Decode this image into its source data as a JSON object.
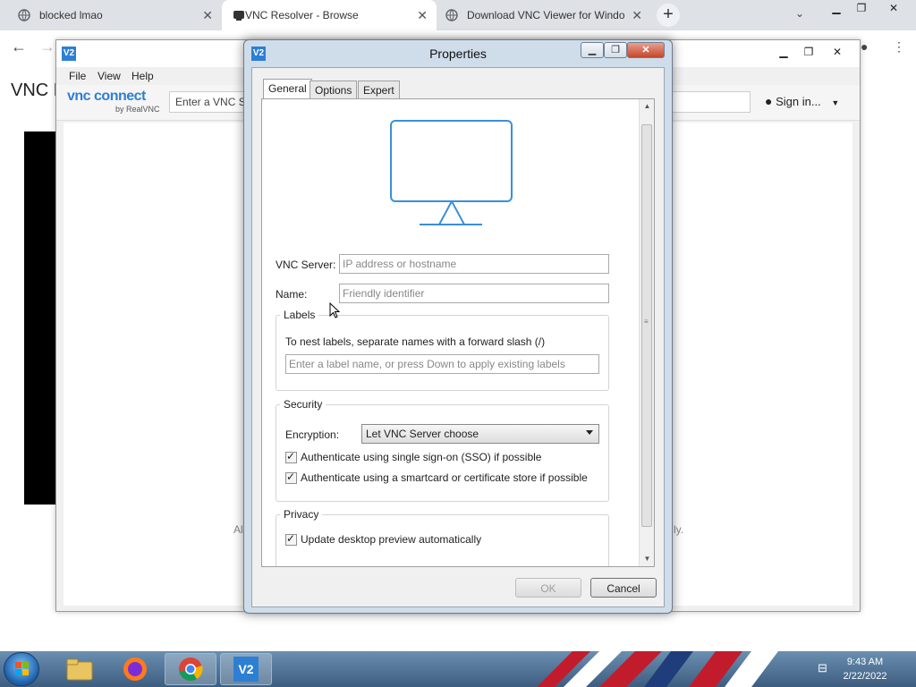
{
  "browser": {
    "tabs": [
      {
        "title": "blocked lmao",
        "active": false
      },
      {
        "title": "VNC Resolver - Browse",
        "active": true
      },
      {
        "title": "Download VNC Viewer for Windo",
        "active": false
      }
    ],
    "new_tab_symbol": "+",
    "page_heading_partial": "VNC R"
  },
  "vnc_window": {
    "menu": [
      "File",
      "View",
      "Help"
    ],
    "logo": "vnc connect",
    "logo_sub": "by RealVNC",
    "address_placeholder": "Enter a VNC Se",
    "sign_in": "Sign in...",
    "hidden_left": "Al",
    "hidden_right": "ly."
  },
  "dialog": {
    "title": "Properties",
    "app_icon_text": "V2",
    "tabs": [
      "General",
      "Options",
      "Expert"
    ],
    "selected_tab": "General",
    "vnc_server": {
      "label": "VNC Server:",
      "placeholder": "IP address or hostname"
    },
    "name": {
      "label": "Name:",
      "placeholder": "Friendly identifier"
    },
    "labels": {
      "legend": "Labels",
      "help": "To nest labels, separate names with a forward slash (/)",
      "placeholder": "Enter a label name, or press Down to apply existing labels"
    },
    "security": {
      "legend": "Security",
      "encryption_label": "Encryption:",
      "encryption_value": "Let VNC Server choose",
      "sso": {
        "label": "Authenticate using single sign-on (SSO) if possible",
        "checked": true
      },
      "smartcard": {
        "label": "Authenticate using a smartcard or certificate store if possible",
        "checked": true
      }
    },
    "privacy": {
      "legend": "Privacy",
      "preview": {
        "label": "Update desktop preview automatically",
        "checked": true
      }
    },
    "buttons": {
      "ok": "OK",
      "cancel": "Cancel"
    }
  },
  "taskbar": {
    "time": "9:43 AM",
    "date": "2/22/2022",
    "vnc_icon_text": "V2"
  },
  "colors": {
    "vnc_blue": "#2d7fd3",
    "dialog_frame": "#cfdcea",
    "taskbar": "#4f7396"
  }
}
